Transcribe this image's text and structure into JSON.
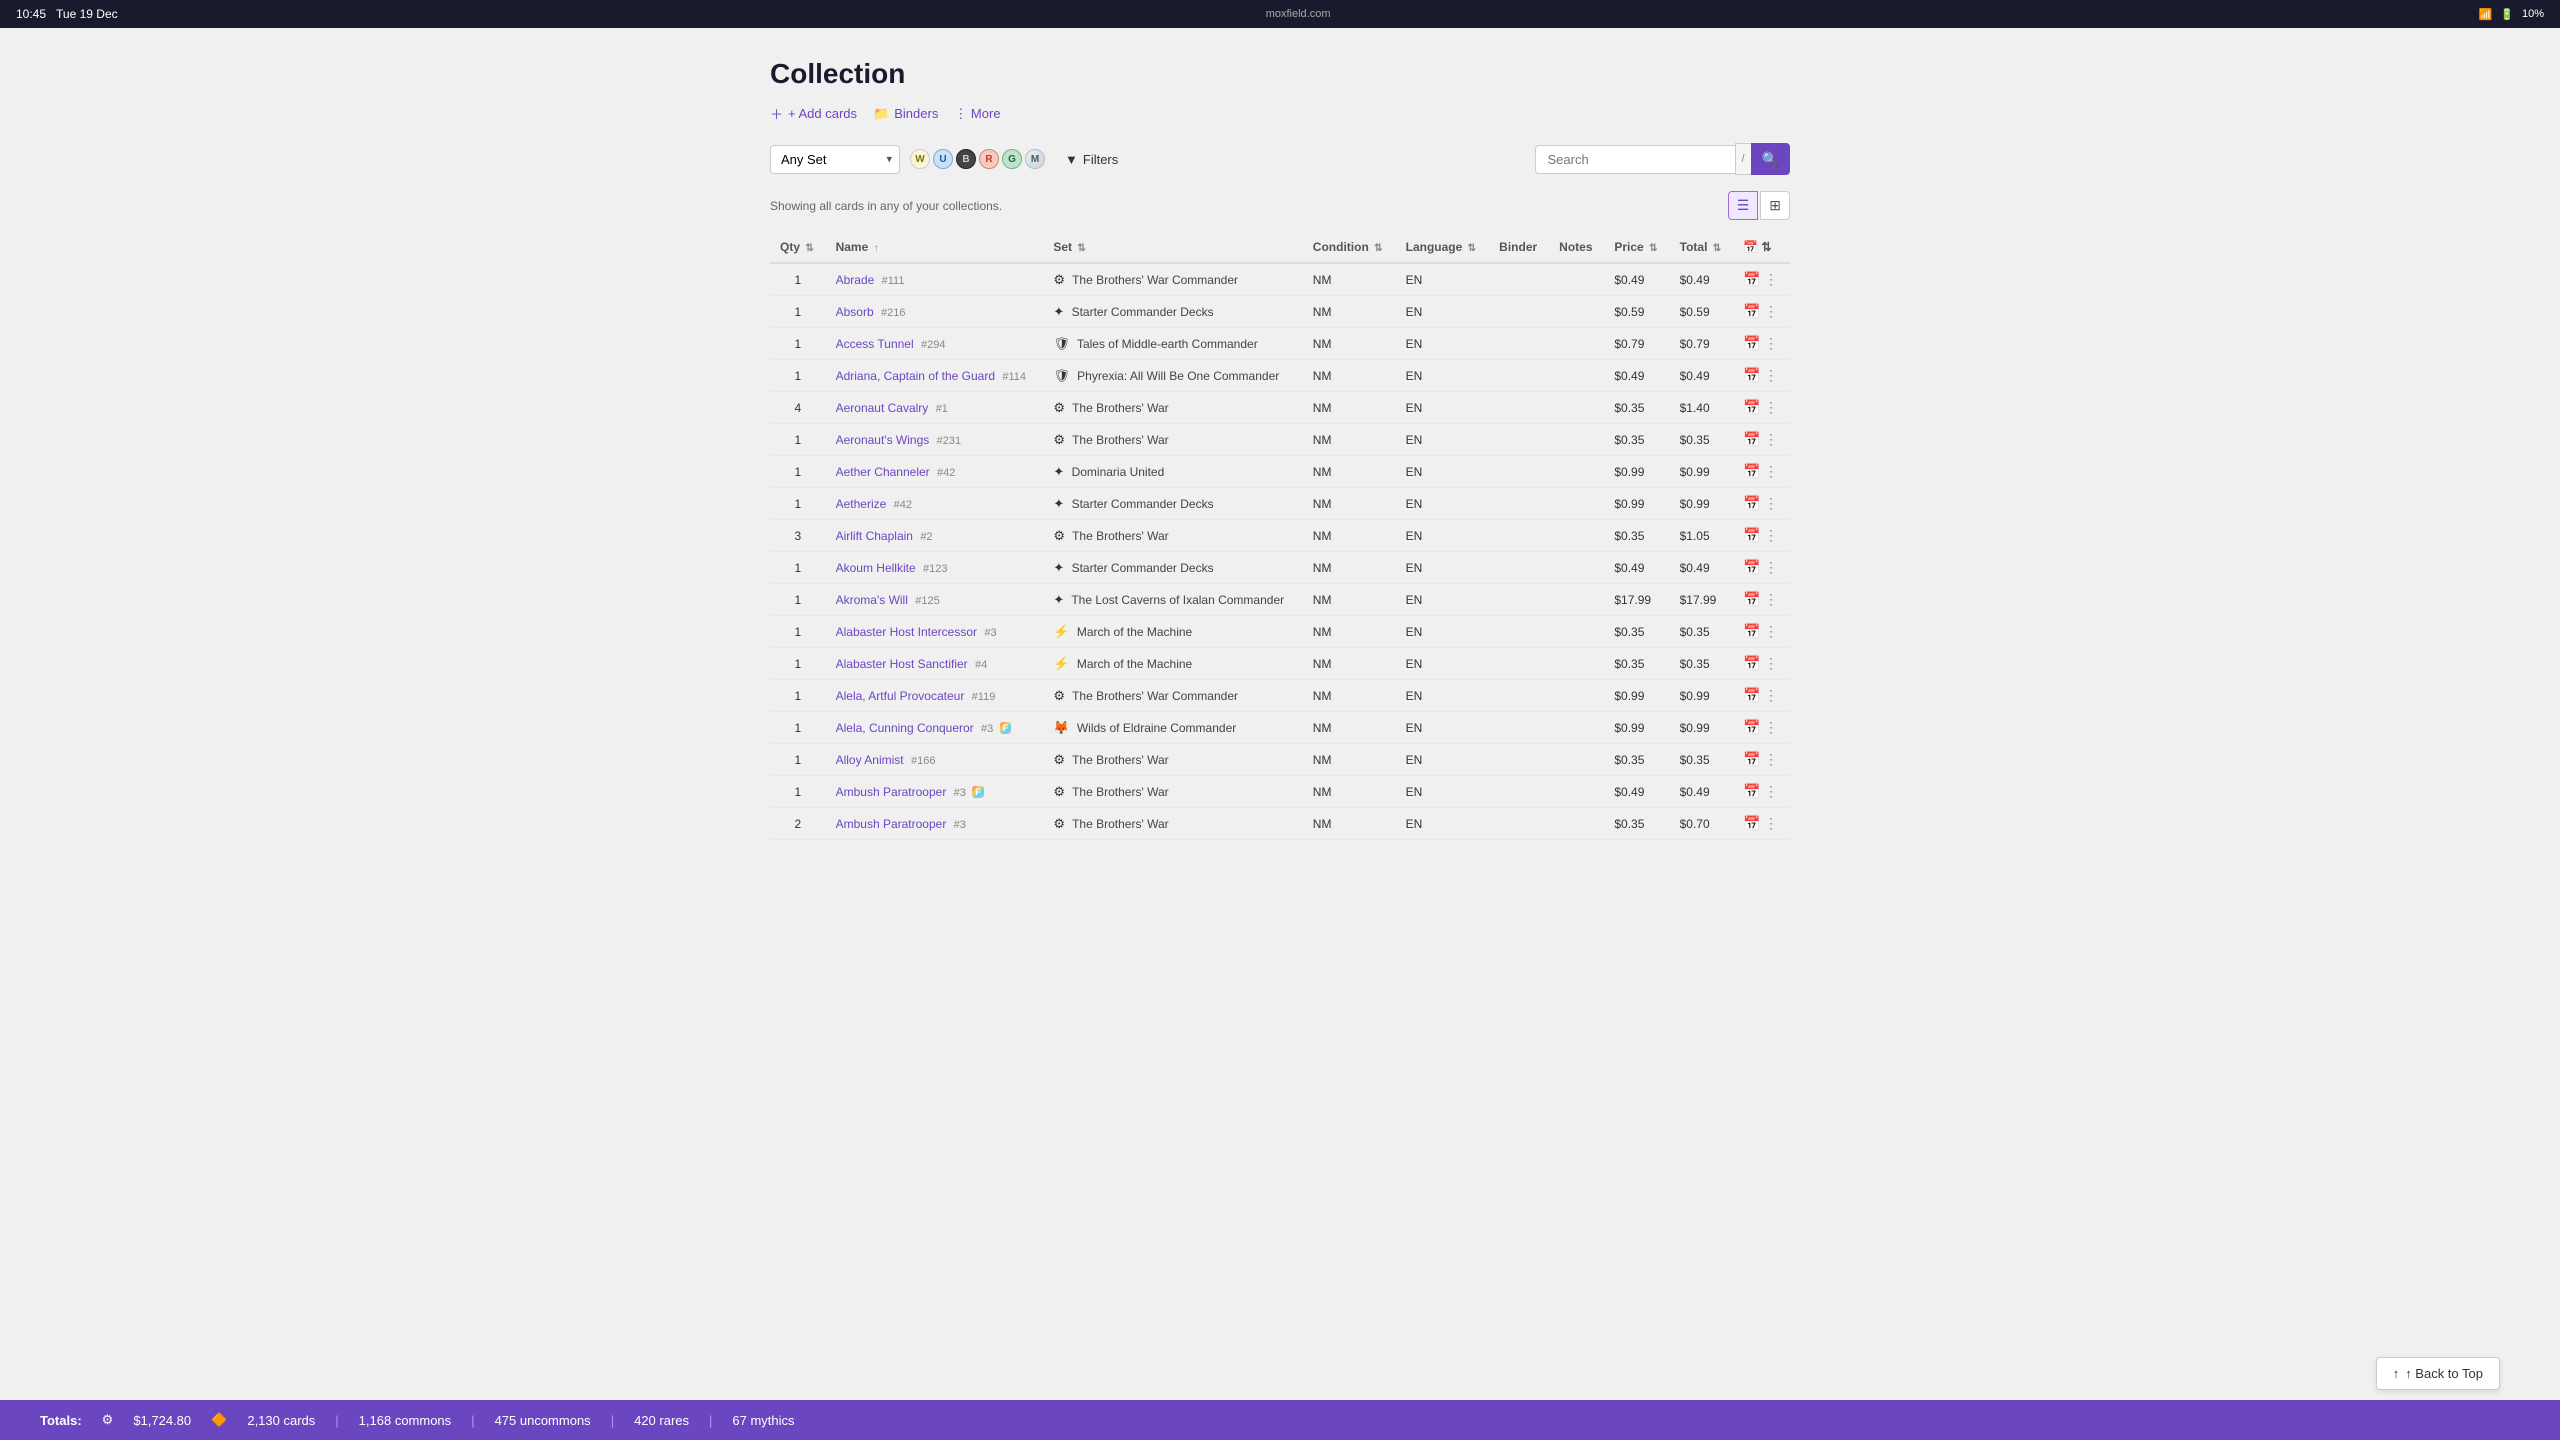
{
  "topbar": {
    "time": "10:45",
    "date": "Tue 19 Dec",
    "site": "moxfield.com",
    "battery": "10%",
    "dots": "···"
  },
  "page": {
    "title": "Collection",
    "add_cards": "+ Add cards",
    "binders": "Binders",
    "more": "⋮ More",
    "status_text": "Showing all cards in any of your collections."
  },
  "filters": {
    "set_placeholder": "Any Set",
    "filters_label": "Filters",
    "search_placeholder": "Search",
    "kbd_shortcut": "/"
  },
  "table": {
    "headers": [
      "Qty",
      "Name",
      "Set",
      "Condition",
      "Language",
      "Binder",
      "Notes",
      "Price",
      "Total",
      ""
    ],
    "rows": [
      {
        "qty": "1",
        "name": "Abrade",
        "number": "#111",
        "set_name": "The Brothers' War Commander",
        "condition": "NM",
        "language": "EN",
        "binder": "",
        "notes": "",
        "price": "$0.49",
        "total": "$0.49",
        "foil": false
      },
      {
        "qty": "1",
        "name": "Absorb",
        "number": "#216",
        "set_name": "Starter Commander Decks",
        "condition": "NM",
        "language": "EN",
        "binder": "",
        "notes": "",
        "price": "$0.59",
        "total": "$0.59",
        "foil": false
      },
      {
        "qty": "1",
        "name": "Access Tunnel",
        "number": "#294",
        "set_name": "Tales of Middle-earth Commander",
        "condition": "NM",
        "language": "EN",
        "binder": "",
        "notes": "",
        "price": "$0.79",
        "total": "$0.79",
        "foil": false
      },
      {
        "qty": "1",
        "name": "Adriana, Captain of the Guard",
        "number": "#114",
        "set_name": "Phyrexia: All Will Be One Commander",
        "condition": "NM",
        "language": "EN",
        "binder": "",
        "notes": "",
        "price": "$0.49",
        "total": "$0.49",
        "foil": false
      },
      {
        "qty": "4",
        "name": "Aeronaut Cavalry",
        "number": "#1",
        "set_name": "The Brothers' War",
        "condition": "NM",
        "language": "EN",
        "binder": "",
        "notes": "",
        "price": "$0.35",
        "total": "$1.40",
        "foil": false
      },
      {
        "qty": "1",
        "name": "Aeronaut's Wings",
        "number": "#231",
        "set_name": "The Brothers' War",
        "condition": "NM",
        "language": "EN",
        "binder": "",
        "notes": "",
        "price": "$0.35",
        "total": "$0.35",
        "foil": false
      },
      {
        "qty": "1",
        "name": "Aether Channeler",
        "number": "#42",
        "set_name": "Dominaria United",
        "condition": "NM",
        "language": "EN",
        "binder": "",
        "notes": "",
        "price": "$0.99",
        "total": "$0.99",
        "foil": false
      },
      {
        "qty": "1",
        "name": "Aetherize",
        "number": "#42",
        "set_name": "Starter Commander Decks",
        "condition": "NM",
        "language": "EN",
        "binder": "",
        "notes": "",
        "price": "$0.99",
        "total": "$0.99",
        "foil": false
      },
      {
        "qty": "3",
        "name": "Airlift Chaplain",
        "number": "#2",
        "set_name": "The Brothers' War",
        "condition": "NM",
        "language": "EN",
        "binder": "",
        "notes": "",
        "price": "$0.35",
        "total": "$1.05",
        "foil": false
      },
      {
        "qty": "1",
        "name": "Akoum Hellkite",
        "number": "#123",
        "set_name": "Starter Commander Decks",
        "condition": "NM",
        "language": "EN",
        "binder": "",
        "notes": "",
        "price": "$0.49",
        "total": "$0.49",
        "foil": false
      },
      {
        "qty": "1",
        "name": "Akroma's Will",
        "number": "#125",
        "set_name": "The Lost Caverns of Ixalan Commander",
        "condition": "NM",
        "language": "EN",
        "binder": "",
        "notes": "",
        "price": "$17.99",
        "total": "$17.99",
        "foil": false
      },
      {
        "qty": "1",
        "name": "Alabaster Host Intercessor",
        "number": "#3",
        "set_name": "March of the Machine",
        "condition": "NM",
        "language": "EN",
        "binder": "",
        "notes": "",
        "price": "$0.35",
        "total": "$0.35",
        "foil": false
      },
      {
        "qty": "1",
        "name": "Alabaster Host Sanctifier",
        "number": "#4",
        "set_name": "March of the Machine",
        "condition": "NM",
        "language": "EN",
        "binder": "",
        "notes": "",
        "price": "$0.35",
        "total": "$0.35",
        "foil": false
      },
      {
        "qty": "1",
        "name": "Alela, Artful Provocateur",
        "number": "#119",
        "set_name": "The Brothers' War Commander",
        "condition": "NM",
        "language": "EN",
        "binder": "",
        "notes": "",
        "price": "$0.99",
        "total": "$0.99",
        "foil": false
      },
      {
        "qty": "1",
        "name": "Alela, Cunning Conqueror",
        "number": "#3",
        "set_name": "Wilds of Eldraine Commander",
        "condition": "NM",
        "language": "EN",
        "binder": "",
        "notes": "",
        "price": "$0.99",
        "total": "$0.99",
        "foil": true
      },
      {
        "qty": "1",
        "name": "Alloy Animist",
        "number": "#166",
        "set_name": "The Brothers' War",
        "condition": "NM",
        "language": "EN",
        "binder": "",
        "notes": "",
        "price": "$0.35",
        "total": "$0.35",
        "foil": false
      },
      {
        "qty": "1",
        "name": "Ambush Paratrooper",
        "number": "#3",
        "set_name": "The Brothers' War",
        "condition": "NM",
        "language": "EN",
        "binder": "",
        "notes": "",
        "price": "$0.49",
        "total": "$0.49",
        "foil": true
      },
      {
        "qty": "2",
        "name": "Ambush Paratrooper",
        "number": "#3",
        "set_name": "The Brothers' War",
        "condition": "NM",
        "language": "EN",
        "binder": "",
        "notes": "",
        "price": "$0.35",
        "total": "$0.70",
        "foil": false
      }
    ]
  },
  "footer": {
    "label": "Totals:",
    "total_value": "$1,724.80",
    "card_count": "2,130 cards",
    "commons": "1,168 commons",
    "uncommons": "475 uncommons",
    "rares": "420 rares",
    "mythics": "67 mythics"
  },
  "back_to_top": "↑ Back to Top",
  "set_icons": {
    "brothers_war_commander": "⚙",
    "starter_commander": "✦",
    "middle_earth_commander": "🛡",
    "phyrexia_commander": "🛡",
    "brothers_war": "⚙",
    "dominaria_united": "✦",
    "march_machine": "⚡",
    "lost_caverns_commander": "✦",
    "wilds_eldraine_commander": "🦊"
  }
}
